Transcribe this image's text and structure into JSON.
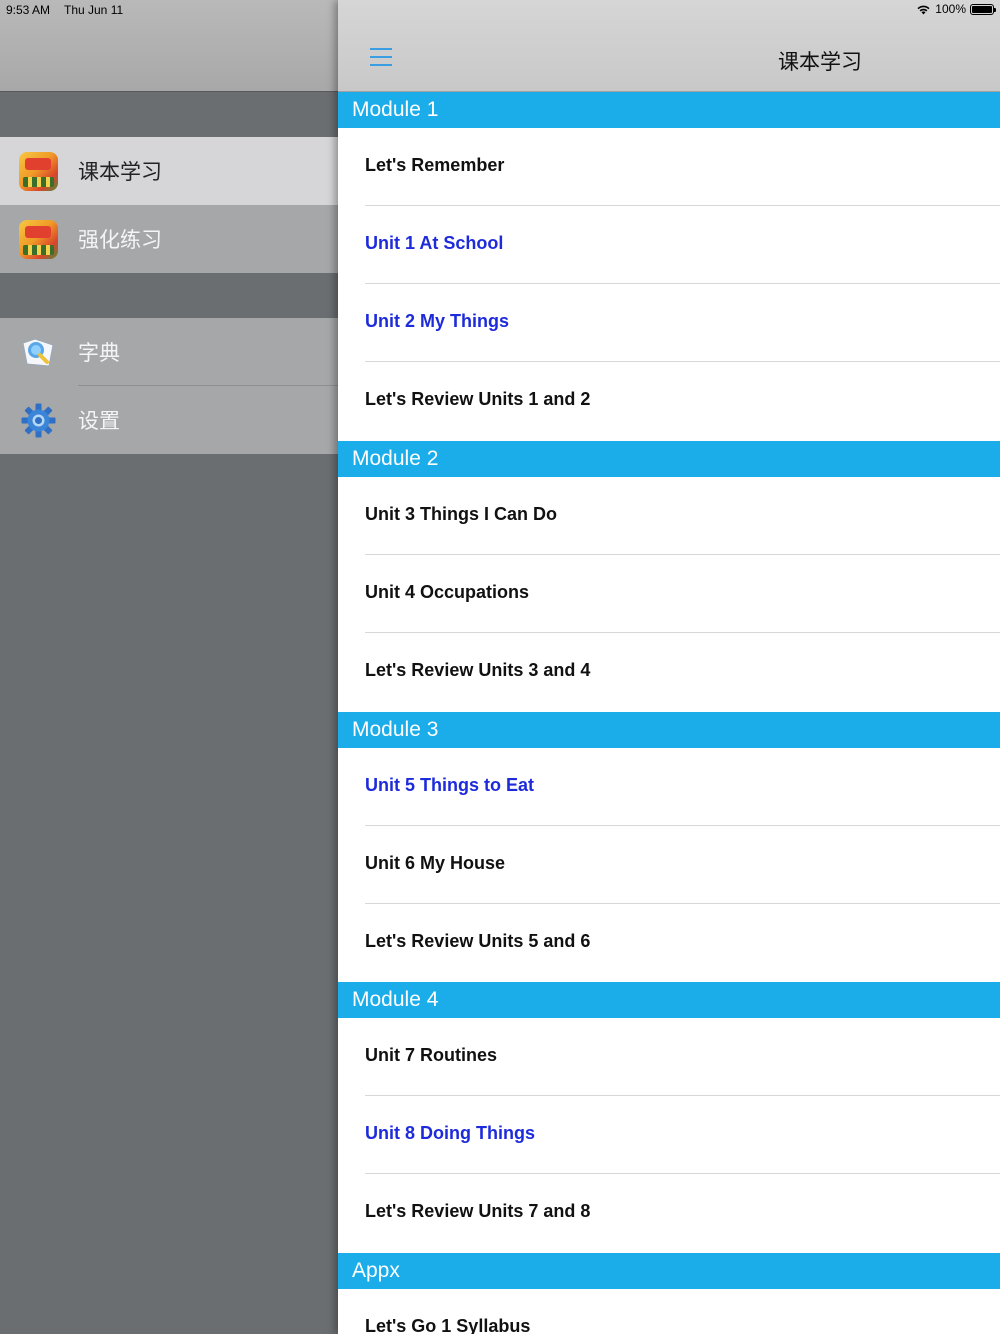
{
  "status_bar": {
    "time": "9:53 AM",
    "date": "Thu Jun 11",
    "battery": "100%",
    "battery_level": 1.0
  },
  "sidebar": {
    "groups": [
      {
        "items": [
          {
            "label": "课本学习",
            "icon": "app-icon",
            "selected": true
          },
          {
            "label": "强化练习",
            "icon": "app-icon",
            "selected": false
          }
        ]
      },
      {
        "items": [
          {
            "label": "字典",
            "icon": "dictionary-icon",
            "selected": false
          },
          {
            "label": "设置",
            "icon": "gear-icon",
            "selected": false
          }
        ]
      }
    ]
  },
  "navbar": {
    "title": "课本学习",
    "menu_icon": "hamburger-menu-icon"
  },
  "sections": [
    {
      "title": "Module 1",
      "items": [
        {
          "label": "Let's Remember",
          "link": false
        },
        {
          "label": "Unit 1 At School",
          "link": true
        },
        {
          "label": "Unit 2 My Things",
          "link": true
        },
        {
          "label": "Let's Review Units 1 and 2",
          "link": false
        }
      ]
    },
    {
      "title": "Module 2",
      "items": [
        {
          "label": "Unit 3 Things I Can Do",
          "link": false
        },
        {
          "label": "Unit 4 Occupations",
          "link": false
        },
        {
          "label": "Let's Review Units 3 and 4",
          "link": false
        }
      ]
    },
    {
      "title": "Module 3",
      "items": [
        {
          "label": "Unit 5 Things to Eat",
          "link": true
        },
        {
          "label": "Unit 6 My House",
          "link": false
        },
        {
          "label": "Let's Review Units 5 and 6",
          "link": false
        }
      ]
    },
    {
      "title": "Module 4",
      "items": [
        {
          "label": "Unit 7 Routines",
          "link": false
        },
        {
          "label": "Unit 8 Doing Things",
          "link": true
        },
        {
          "label": "Let's Review Units 7 and 8",
          "link": false
        }
      ]
    },
    {
      "title": "Appx",
      "items": [
        {
          "label": "Let's Go 1 Syllabus",
          "link": false
        }
      ]
    }
  ],
  "colors": {
    "section_header": "#1badea",
    "link_text": "#1d2bdb",
    "accent": "#3b9ee3"
  }
}
